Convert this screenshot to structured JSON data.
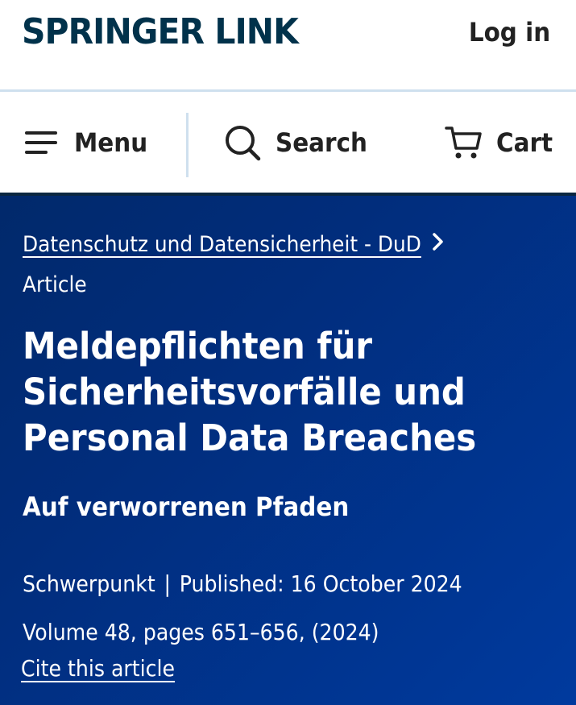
{
  "header": {
    "logo_text": "SPRINGER LINK",
    "login_label": "Log in"
  },
  "nav": {
    "menu_label": "Menu",
    "search_label": "Search",
    "cart_label": "Cart"
  },
  "article": {
    "breadcrumb_journal": "Datenschutz und Datensicherheit - DuD",
    "type": "Article",
    "title": "Meldepflichten für Sicherheitsvorfälle und Personal Data Breaches",
    "subtitle": "Auf verworrenen Pfaden",
    "section": "Schwerpunkt",
    "separator": "|",
    "published": "Published: 16 October 2024",
    "volume_info": "Volume 48, pages 651–656, (2024)",
    "cite_label": "Cite this article"
  },
  "colors": {
    "brand_dark": "#01324b",
    "hero_blue": "#012d7c",
    "divider": "#cfe0ee"
  },
  "icons": {
    "menu": "hamburger-icon",
    "search": "search-icon",
    "cart": "cart-icon",
    "breadcrumb": "chevron-right-icon"
  }
}
